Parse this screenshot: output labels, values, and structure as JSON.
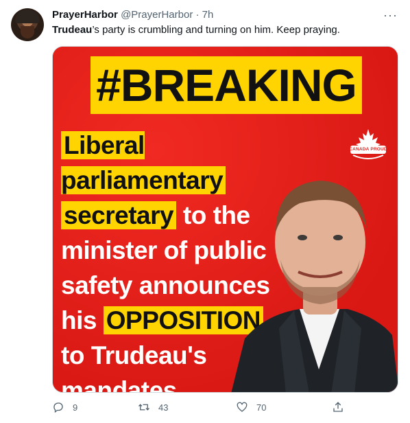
{
  "tweet": {
    "display_name": "PrayerHarbor",
    "handle": "@PrayerHarbor",
    "separator": "·",
    "time": "7h",
    "more": "···",
    "text_bold": "Trudeau",
    "text_rest": "’s party is crumbling and turning on him. Keep praying."
  },
  "image": {
    "breaking": "#BREAKING",
    "headline": {
      "hl1": "Liberal parliamentary",
      "hl2": "secretary",
      "t1": " to the",
      "t2": "minister of public",
      "t3": "safety announces",
      "t4": "his ",
      "hl3": "OPPOSITION",
      "t5": "to Trudeau's",
      "t6": "mandates."
    },
    "logo_text": "CANADA PROUD"
  },
  "actions": {
    "reply_count": "9",
    "retweet_count": "43",
    "like_count": "70"
  },
  "colors": {
    "background_red": "#e8231f",
    "highlight_yellow": "#ffd400",
    "secondary_text": "#536471"
  }
}
